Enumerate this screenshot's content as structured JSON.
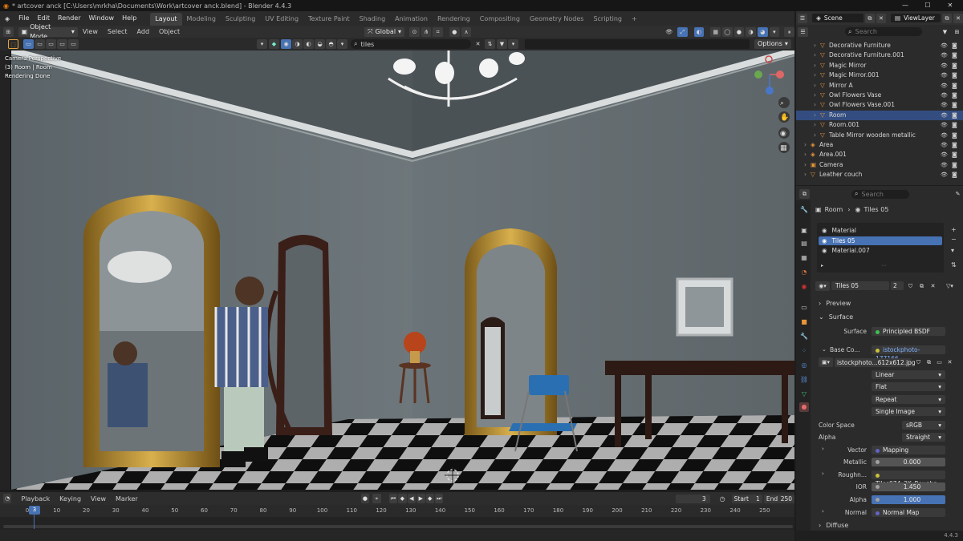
{
  "window": {
    "title": "* artcover anck [C:\\Users\\mrkha\\Documents\\Work\\artcover anck.blend] - Blender 4.4.3",
    "controls": [
      "—",
      "☐",
      "✕"
    ]
  },
  "menu": {
    "items": [
      "File",
      "Edit",
      "Render",
      "Window",
      "Help"
    ],
    "workspaces": [
      "Layout",
      "Modeling",
      "Sculpting",
      "UV Editing",
      "Texture Paint",
      "Shading",
      "Animation",
      "Rendering",
      "Compositing",
      "Geometry Nodes",
      "Scripting"
    ],
    "add_tab": "+"
  },
  "viewport_header": {
    "mode": "Object Mode",
    "menus": [
      "View",
      "Select",
      "Add",
      "Object"
    ],
    "transform": "Global",
    "search_value": "tiles",
    "options": "Options"
  },
  "viewport": {
    "overlay_lines": [
      "Camera Perspective",
      "(3) Room | Room",
      "Rendering Done"
    ]
  },
  "top_right": {
    "scene": "Scene",
    "view_layer": "ViewLayer"
  },
  "outliner": {
    "search_placeholder": "Search",
    "rows": [
      {
        "name": "Decorative Furniture",
        "indent": 2
      },
      {
        "name": "Decorative Furniture.001",
        "indent": 2
      },
      {
        "name": "Magic Mirror",
        "indent": 2
      },
      {
        "name": "Magic Mirror.001",
        "indent": 2
      },
      {
        "name": "Mirror A",
        "indent": 2
      },
      {
        "name": "Owl Flowers Vase",
        "indent": 2
      },
      {
        "name": "Owl Flowers Vase.001",
        "indent": 2
      },
      {
        "name": "Room",
        "indent": 2,
        "selected": true
      },
      {
        "name": "Room.001",
        "indent": 2
      },
      {
        "name": "Table Mirror wooden metallic",
        "indent": 2
      },
      {
        "name": "Area",
        "indent": 1
      },
      {
        "name": "Area.001",
        "indent": 1
      },
      {
        "name": "Camera",
        "indent": 1
      },
      {
        "name": "Leather couch",
        "indent": 1
      }
    ]
  },
  "properties": {
    "search_placeholder": "Search",
    "breadcrumb": [
      "Room",
      "Tiles 05"
    ],
    "slots": [
      {
        "name": "Material",
        "selected": false
      },
      {
        "name": "Tiles 05",
        "selected": true
      },
      {
        "name": "Material.007",
        "selected": false
      }
    ],
    "material_name": "Tiles 05",
    "material_users": "2",
    "sections": {
      "preview": "Preview",
      "surface": "Surface",
      "diffuse": "Diffuse"
    },
    "surface_label": "Surface",
    "surface_value": "Principled BSDF",
    "base_color_label": "Base Co...",
    "base_color_value": "istockphoto-177166...",
    "image_name": "istockphoto...612x612.jpg",
    "interpolation": "Linear",
    "projection": "Flat",
    "extension": "Repeat",
    "source": "Single Image",
    "color_space_label": "Color Space",
    "color_space_value": "sRGB",
    "alpha_label": "Alpha",
    "alpha_mode": "Straight",
    "vector_label": "Vector",
    "vector_value": "Mapping",
    "metallic_label": "Metallic",
    "metallic_value": "0.000",
    "roughness_label": "Roughn...",
    "roughness_value": "Tiles074_2K_Roughn...",
    "ior_label": "IOR",
    "ior_value": "1.450",
    "alpha2_label": "Alpha",
    "alpha2_value": "1.000",
    "normal_label": "Normal",
    "normal_value": "Normal Map"
  },
  "timeline": {
    "menus": [
      "Playback",
      "Keying",
      "View",
      "Marker"
    ],
    "current_frame": "3",
    "start_label": "Start",
    "start": "1",
    "end_label": "End",
    "end": "250",
    "ticks": [
      "0",
      "10",
      "20",
      "30",
      "40",
      "50",
      "60",
      "70",
      "80",
      "90",
      "100",
      "110",
      "120",
      "130",
      "140",
      "150",
      "160",
      "170",
      "180",
      "190",
      "200",
      "210",
      "220",
      "230",
      "240",
      "250"
    ]
  },
  "status": {
    "version": "4.4.3"
  }
}
